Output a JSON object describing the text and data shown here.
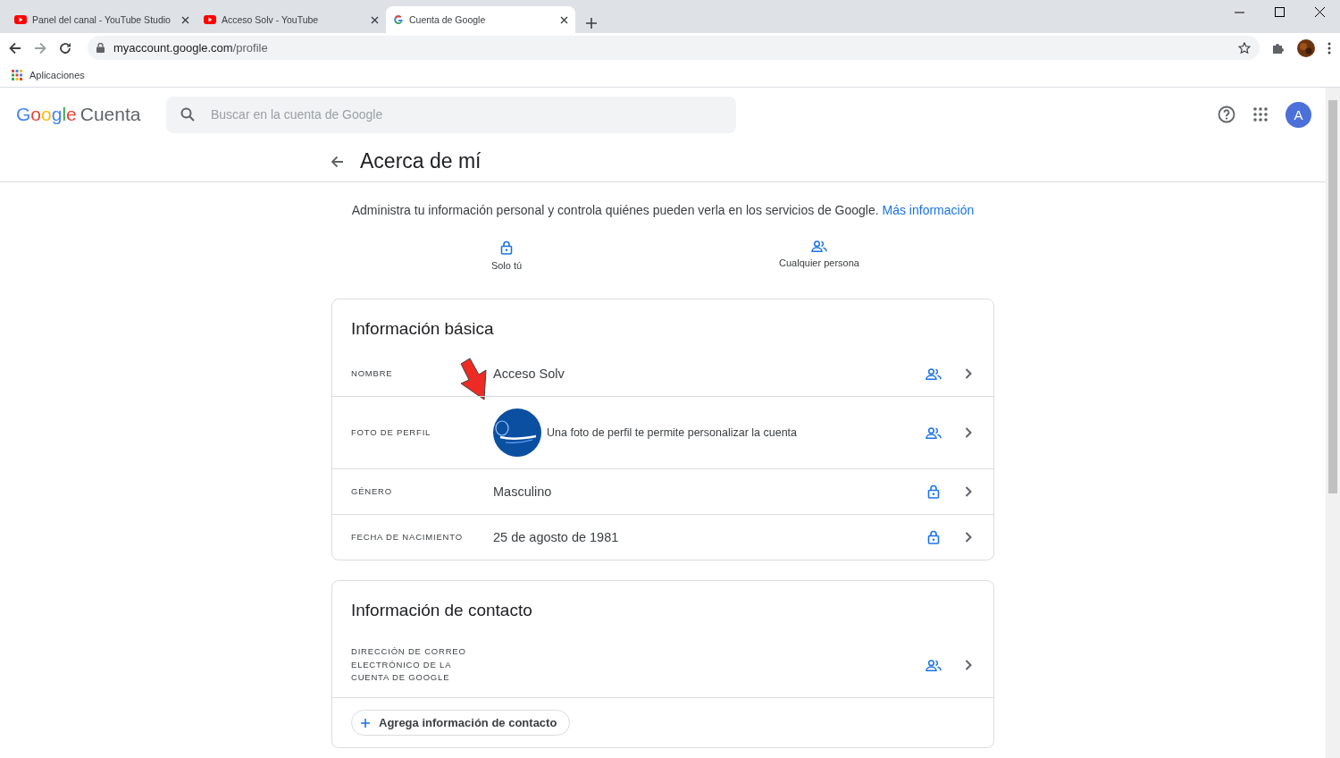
{
  "browser": {
    "tabs": [
      {
        "title": "Panel del canal - YouTube Studio",
        "kind": "youtube",
        "selected": false
      },
      {
        "title": "Acceso Solv - YouTube",
        "kind": "youtube",
        "selected": false
      },
      {
        "title": "Cuenta de Google",
        "kind": "google",
        "selected": true
      }
    ],
    "url_host": "myaccount.google.com",
    "url_path": "/profile",
    "bookmarks": [
      "Aplicaciones"
    ]
  },
  "header": {
    "logo": "Google",
    "product": "Cuenta",
    "search_placeholder": "Buscar en la cuenta de Google",
    "avatar": "A"
  },
  "page_title": "Acerca de mí",
  "intro": {
    "text": "Administra tu información personal y controla quiénes pueden verla en los servicios de Google.",
    "link": "Más información"
  },
  "legend": [
    {
      "kind": "lock",
      "label": "Solo tú"
    },
    {
      "kind": "people",
      "label": "Cualquier persona"
    }
  ],
  "sections": [
    {
      "title": "Información básica",
      "rows": [
        {
          "label": "NOMBRE",
          "value": "Acceso Solv",
          "shared": true
        },
        {
          "label": "FOTO DE PERFIL",
          "value": "Una foto de perfil te permite personalizar la cuenta",
          "shared": true
        },
        {
          "label": "GÉNERO",
          "value": "Masculino",
          "shared": false
        },
        {
          "label": "FECHA DE NACIMIENTO",
          "value": "25 de agosto de 1981",
          "shared": false
        }
      ]
    },
    {
      "title": "Información de contacto",
      "rows": [
        {
          "label": "DIRECCIÓN DE CORREO ELECTRÓNICO DE LA CUENTA DE GOOGLE",
          "shared": true
        }
      ],
      "action": "Agrega información de contacto"
    }
  ]
}
